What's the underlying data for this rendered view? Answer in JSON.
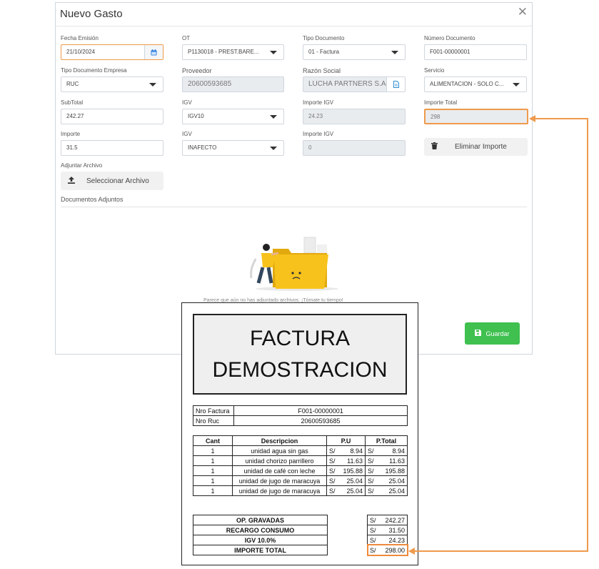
{
  "modal": {
    "title": "Nuevo Gasto",
    "close": "✕",
    "fields": {
      "fecha_emision": {
        "label": "Fecha Emisión",
        "value": "21/10/2024"
      },
      "ot": {
        "label": "OT",
        "value": "P1130018 - PREST.BARE..."
      },
      "tipo_documento": {
        "label": "Tipo Documento",
        "value": "01 - Factura"
      },
      "numero_documento": {
        "label": "Número Documento",
        "value": "F001-00000001"
      },
      "tipo_doc_empresa": {
        "label": "Tipo Documento Empresa",
        "value": "RUC"
      },
      "proveedor": {
        "label": "Proveedor",
        "value": "20600593685"
      },
      "razon_social": {
        "label": "Razón Social",
        "value": "LUCHA PARTNERS S.A.C"
      },
      "servicio": {
        "label": "Servicio",
        "value": "ALIMENTACION - SOLO C..."
      },
      "subtotal": {
        "label": "SubTotal",
        "value": "242.27"
      },
      "igv1": {
        "label": "IGV",
        "value": "IGV10"
      },
      "importe_igv1": {
        "label": "Importe IGV",
        "value": "24.23"
      },
      "importe_total": {
        "label": "Importe Total",
        "value": "298"
      },
      "importe": {
        "label": "Importe",
        "value": "31.5"
      },
      "igv2": {
        "label": "IGV",
        "value": "INAFECTO"
      },
      "importe_igv2": {
        "label": "Importe IGV",
        "value": "0"
      }
    },
    "eliminar_importe": "Eliminar Importe",
    "adjuntar_label": "Adjuntar Archivo",
    "seleccionar_archivo": "Seleccionar Archivo",
    "documentos_adjuntos": "Documentos Adjuntos",
    "empty_message": "Parece que aún no has adjuntado archivos. ¡Tómate tu tiempo!",
    "guardar": "Guardar"
  },
  "invoice": {
    "title": "FACTURA DEMOSTRACION",
    "nro_factura_label": "Nro Factura",
    "nro_factura": "F001-00000001",
    "nro_ruc_label": "Nro Ruc",
    "nro_ruc": "20600593685",
    "headers": {
      "cant": "Cant",
      "desc": "Descripcion",
      "pu": "P.U",
      "ptotal": "P.Total"
    },
    "currency": "S/",
    "items": [
      {
        "cant": "1",
        "desc": "unidad agua sin gas",
        "pu": "8.94",
        "total": "8.94"
      },
      {
        "cant": "1",
        "desc": "unidad chorizo parrillero",
        "pu": "11.63",
        "total": "11.63"
      },
      {
        "cant": "1",
        "desc": "unidad de café con leche",
        "pu": "195.88",
        "total": "195.88"
      },
      {
        "cant": "1",
        "desc": "unidad de jugo de maracuya",
        "pu": "25.04",
        "total": "25.04"
      },
      {
        "cant": "1",
        "desc": "unidad de jugo de maracuya",
        "pu": "25.04",
        "total": "25.04"
      }
    ],
    "totals": [
      {
        "label": "OP. GRAVADAS",
        "value": "242.27"
      },
      {
        "label": "RECARGO CONSUMO",
        "value": "31.50"
      },
      {
        "label": "IGV 10.0%",
        "value": "24.23"
      },
      {
        "label": "IMPORTE TOTAL",
        "value": "298.00"
      }
    ]
  },
  "colors": {
    "highlight": "#ef8a3c",
    "green": "#3fc04f",
    "folder": "#f7c21c",
    "calendar": "#2f7fe0"
  }
}
